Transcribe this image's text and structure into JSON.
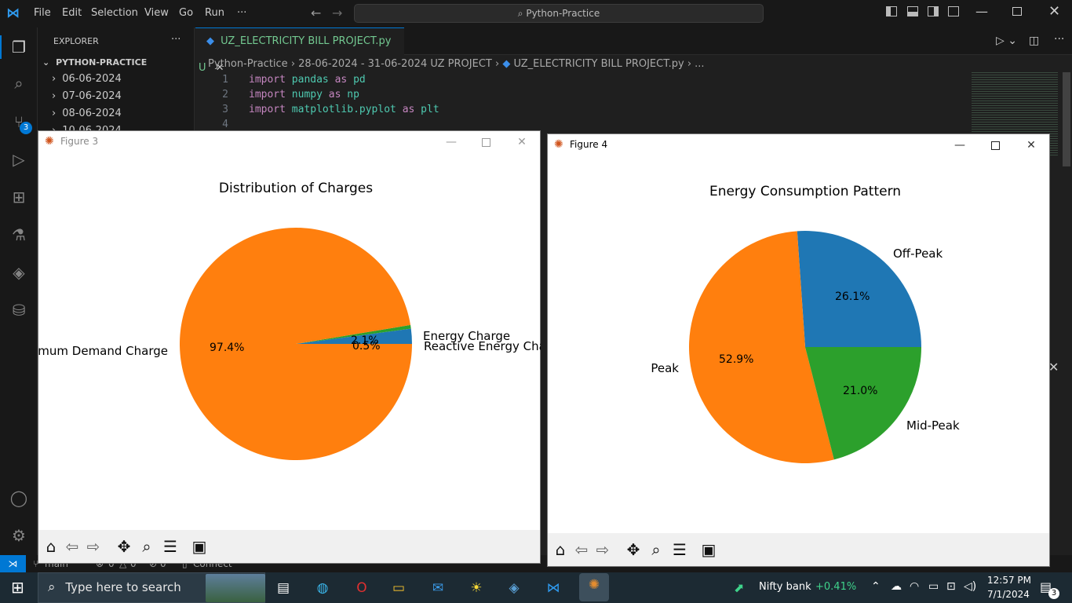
{
  "vscode": {
    "menu": [
      "File",
      "Edit",
      "Selection",
      "View",
      "Go",
      "Run",
      "···"
    ],
    "search_label": "Python-Practice",
    "explorer_title": "EXPLORER",
    "explorer_more": "···",
    "project_name": "PYTHON-PRACTICE",
    "folders": [
      "06-06-2024",
      "07-06-2024",
      "08-06-2024",
      "10-06-2024"
    ],
    "tab": {
      "name": "UZ_ELECTRICITY BILL PROJECT.py",
      "status": "U"
    },
    "breadcrumb": [
      "Python-Practice",
      "28-06-2024 - 31-06-2024 UZ PROJECT",
      "UZ_ELECTRICITY BILL PROJECT.py",
      "..."
    ],
    "code": [
      {
        "n": "1",
        "kw1": "import",
        "mod": "pandas",
        "kw2": "as",
        "alias": "pd"
      },
      {
        "n": "2",
        "kw1": "import",
        "mod": "numpy",
        "kw2": "as",
        "alias": "np"
      },
      {
        "n": "3",
        "kw1": "import",
        "mod": "matplotlib.pyplot",
        "kw2": "as",
        "alias": "plt"
      },
      {
        "n": "4",
        "kw1": "",
        "mod": "",
        "kw2": "",
        "alias": ""
      }
    ],
    "scm_badge": "3",
    "status": {
      "branch": "main",
      "errors": "0",
      "warnings": "0",
      "ports": "0",
      "connect": "Connect"
    }
  },
  "figure3": {
    "title": "Figure 3",
    "chart_data": {
      "type": "pie",
      "title": "Distribution of Charges",
      "categories": [
        "Energy Charge",
        "Reactive Energy Charge",
        "Maximum Demand Charge"
      ],
      "values": [
        2.1,
        0.5,
        97.4
      ],
      "labels_shown": [
        "Energy Charge",
        "Reactive Energy Char",
        "ximum Demand Charge"
      ],
      "pct_labels": [
        "2.1%",
        "0.5%",
        "97.4%"
      ],
      "colors": [
        "#1f77b4",
        "#2ca02c",
        "#ff7f0e"
      ]
    }
  },
  "figure4": {
    "title": "Figure 4",
    "chart_data": {
      "type": "pie",
      "title": "Energy Consumption Pattern",
      "categories": [
        "Off-Peak",
        "Peak",
        "Mid-Peak"
      ],
      "values": [
        26.1,
        52.9,
        21.0
      ],
      "pct_labels": [
        "26.1%",
        "52.9%",
        "21.0%"
      ],
      "colors": [
        "#1f77b4",
        "#ff7f0e",
        "#2ca02c"
      ]
    }
  },
  "taskbar": {
    "search_placeholder": "Type here to search",
    "ticker_name": "Nifty bank",
    "ticker_change": "+0.41%",
    "time": "12:57 PM",
    "date": "7/1/2024",
    "notif_count": "3"
  },
  "colors": {
    "accent": "#0078d4",
    "taskbar": "#1c2a33",
    "positive": "#3fd38b"
  }
}
